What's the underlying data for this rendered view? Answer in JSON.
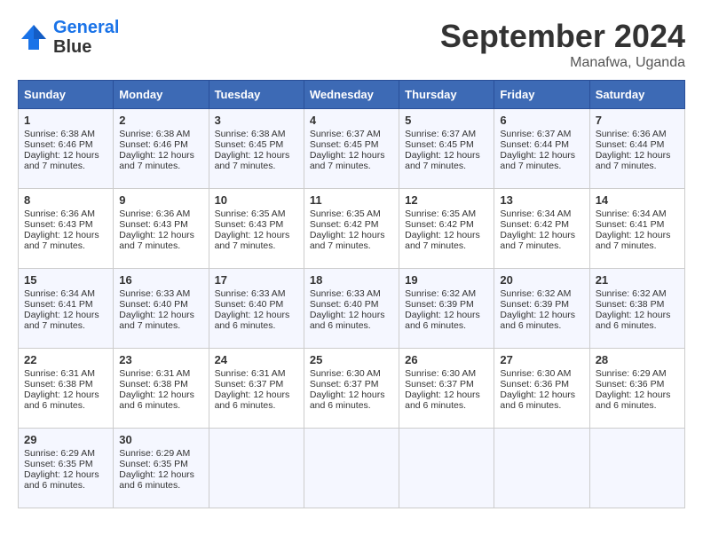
{
  "header": {
    "logo_line1": "General",
    "logo_line2": "Blue",
    "title": "September 2024",
    "subtitle": "Manafwa, Uganda"
  },
  "days_of_week": [
    "Sunday",
    "Monday",
    "Tuesday",
    "Wednesday",
    "Thursday",
    "Friday",
    "Saturday"
  ],
  "weeks": [
    [
      {
        "day": "1",
        "lines": [
          "Sunrise: 6:38 AM",
          "Sunset: 6:46 PM",
          "Daylight: 12 hours",
          "and 7 minutes."
        ]
      },
      {
        "day": "2",
        "lines": [
          "Sunrise: 6:38 AM",
          "Sunset: 6:46 PM",
          "Daylight: 12 hours",
          "and 7 minutes."
        ]
      },
      {
        "day": "3",
        "lines": [
          "Sunrise: 6:38 AM",
          "Sunset: 6:45 PM",
          "Daylight: 12 hours",
          "and 7 minutes."
        ]
      },
      {
        "day": "4",
        "lines": [
          "Sunrise: 6:37 AM",
          "Sunset: 6:45 PM",
          "Daylight: 12 hours",
          "and 7 minutes."
        ]
      },
      {
        "day": "5",
        "lines": [
          "Sunrise: 6:37 AM",
          "Sunset: 6:45 PM",
          "Daylight: 12 hours",
          "and 7 minutes."
        ]
      },
      {
        "day": "6",
        "lines": [
          "Sunrise: 6:37 AM",
          "Sunset: 6:44 PM",
          "Daylight: 12 hours",
          "and 7 minutes."
        ]
      },
      {
        "day": "7",
        "lines": [
          "Sunrise: 6:36 AM",
          "Sunset: 6:44 PM",
          "Daylight: 12 hours",
          "and 7 minutes."
        ]
      }
    ],
    [
      {
        "day": "8",
        "lines": [
          "Sunrise: 6:36 AM",
          "Sunset: 6:43 PM",
          "Daylight: 12 hours",
          "and 7 minutes."
        ]
      },
      {
        "day": "9",
        "lines": [
          "Sunrise: 6:36 AM",
          "Sunset: 6:43 PM",
          "Daylight: 12 hours",
          "and 7 minutes."
        ]
      },
      {
        "day": "10",
        "lines": [
          "Sunrise: 6:35 AM",
          "Sunset: 6:43 PM",
          "Daylight: 12 hours",
          "and 7 minutes."
        ]
      },
      {
        "day": "11",
        "lines": [
          "Sunrise: 6:35 AM",
          "Sunset: 6:42 PM",
          "Daylight: 12 hours",
          "and 7 minutes."
        ]
      },
      {
        "day": "12",
        "lines": [
          "Sunrise: 6:35 AM",
          "Sunset: 6:42 PM",
          "Daylight: 12 hours",
          "and 7 minutes."
        ]
      },
      {
        "day": "13",
        "lines": [
          "Sunrise: 6:34 AM",
          "Sunset: 6:42 PM",
          "Daylight: 12 hours",
          "and 7 minutes."
        ]
      },
      {
        "day": "14",
        "lines": [
          "Sunrise: 6:34 AM",
          "Sunset: 6:41 PM",
          "Daylight: 12 hours",
          "and 7 minutes."
        ]
      }
    ],
    [
      {
        "day": "15",
        "lines": [
          "Sunrise: 6:34 AM",
          "Sunset: 6:41 PM",
          "Daylight: 12 hours",
          "and 7 minutes."
        ]
      },
      {
        "day": "16",
        "lines": [
          "Sunrise: 6:33 AM",
          "Sunset: 6:40 PM",
          "Daylight: 12 hours",
          "and 7 minutes."
        ]
      },
      {
        "day": "17",
        "lines": [
          "Sunrise: 6:33 AM",
          "Sunset: 6:40 PM",
          "Daylight: 12 hours",
          "and 6 minutes."
        ]
      },
      {
        "day": "18",
        "lines": [
          "Sunrise: 6:33 AM",
          "Sunset: 6:40 PM",
          "Daylight: 12 hours",
          "and 6 minutes."
        ]
      },
      {
        "day": "19",
        "lines": [
          "Sunrise: 6:32 AM",
          "Sunset: 6:39 PM",
          "Daylight: 12 hours",
          "and 6 minutes."
        ]
      },
      {
        "day": "20",
        "lines": [
          "Sunrise: 6:32 AM",
          "Sunset: 6:39 PM",
          "Daylight: 12 hours",
          "and 6 minutes."
        ]
      },
      {
        "day": "21",
        "lines": [
          "Sunrise: 6:32 AM",
          "Sunset: 6:38 PM",
          "Daylight: 12 hours",
          "and 6 minutes."
        ]
      }
    ],
    [
      {
        "day": "22",
        "lines": [
          "Sunrise: 6:31 AM",
          "Sunset: 6:38 PM",
          "Daylight: 12 hours",
          "and 6 minutes."
        ]
      },
      {
        "day": "23",
        "lines": [
          "Sunrise: 6:31 AM",
          "Sunset: 6:38 PM",
          "Daylight: 12 hours",
          "and 6 minutes."
        ]
      },
      {
        "day": "24",
        "lines": [
          "Sunrise: 6:31 AM",
          "Sunset: 6:37 PM",
          "Daylight: 12 hours",
          "and 6 minutes."
        ]
      },
      {
        "day": "25",
        "lines": [
          "Sunrise: 6:30 AM",
          "Sunset: 6:37 PM",
          "Daylight: 12 hours",
          "and 6 minutes."
        ]
      },
      {
        "day": "26",
        "lines": [
          "Sunrise: 6:30 AM",
          "Sunset: 6:37 PM",
          "Daylight: 12 hours",
          "and 6 minutes."
        ]
      },
      {
        "day": "27",
        "lines": [
          "Sunrise: 6:30 AM",
          "Sunset: 6:36 PM",
          "Daylight: 12 hours",
          "and 6 minutes."
        ]
      },
      {
        "day": "28",
        "lines": [
          "Sunrise: 6:29 AM",
          "Sunset: 6:36 PM",
          "Daylight: 12 hours",
          "and 6 minutes."
        ]
      }
    ],
    [
      {
        "day": "29",
        "lines": [
          "Sunrise: 6:29 AM",
          "Sunset: 6:35 PM",
          "Daylight: 12 hours",
          "and 6 minutes."
        ]
      },
      {
        "day": "30",
        "lines": [
          "Sunrise: 6:29 AM",
          "Sunset: 6:35 PM",
          "Daylight: 12 hours",
          "and 6 minutes."
        ]
      },
      {
        "day": "",
        "lines": []
      },
      {
        "day": "",
        "lines": []
      },
      {
        "day": "",
        "lines": []
      },
      {
        "day": "",
        "lines": []
      },
      {
        "day": "",
        "lines": []
      }
    ]
  ]
}
